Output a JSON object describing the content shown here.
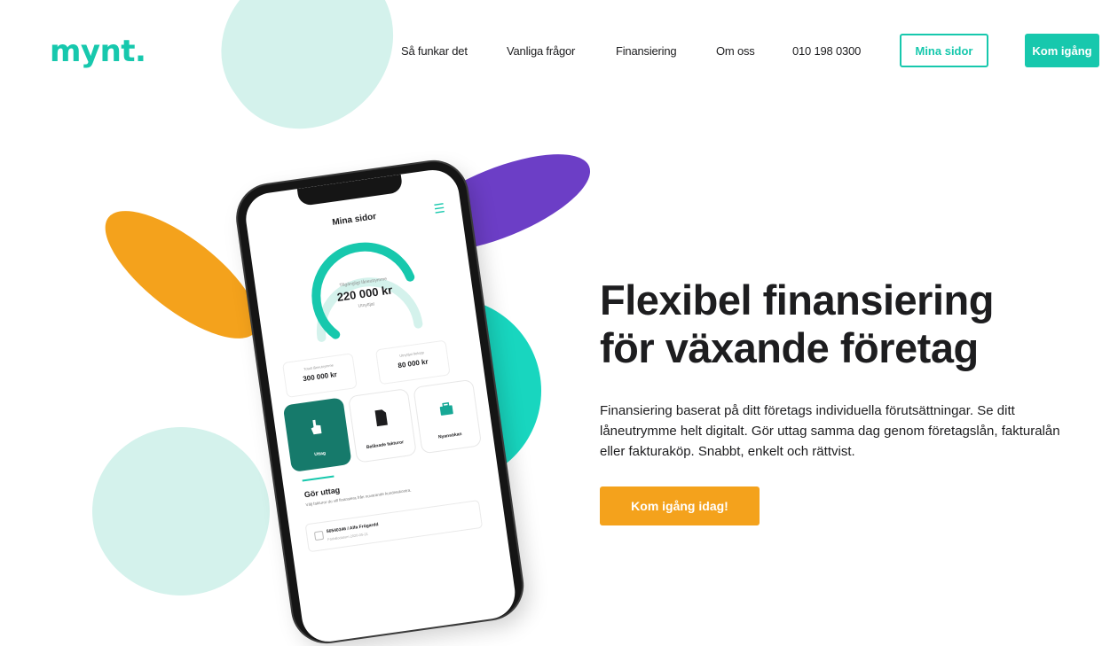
{
  "header": {
    "logo": "mynt.",
    "nav": [
      "Så funkar det",
      "Vanliga frågor",
      "Finansiering",
      "Om oss",
      "010 198 0300"
    ],
    "mina_sidor": "Mina sidor",
    "kom_igang": "Kom igång"
  },
  "hero": {
    "title_line1": "Flexibel finansiering",
    "title_line2": "för växande företag",
    "text": "Finansiering baserat på ditt företags individuella förutsättningar. Se ditt låneutrymme helt digitalt. Gör uttag samma dag genom företagslån, fakturalån eller fakturaköp. Snabbt, enkelt och rättvist.",
    "cta": "Kom igång idag!"
  },
  "phone": {
    "title": "Mina sidor",
    "gauge_label": "Tillgängligt låneutrymme",
    "gauge_amount": "220 000 kr",
    "gauge_sub": "Utnyttjat",
    "gauge_fill": 0.78,
    "card1_label": "Totalt låneutrymme",
    "card1_value": "300 000 kr",
    "card2_label": "Utnyttjat belopp",
    "card2_value": "80 000 kr",
    "tiles": [
      "Uttag",
      "Belånade fakturor",
      "Nyansökan"
    ],
    "gor_uttag_title": "Gör uttag",
    "gor_uttag_text": "Välj fakturor du vill finansiera från nuvarande kundreskontra.",
    "row_text": "56540346 / Alfa Frögardd",
    "row_sub": "Förfallodatum 2020-05-21"
  },
  "colors": {
    "brand": "#17c8ad",
    "orange": "#f4a21c",
    "purple": "#6c3ec6",
    "mint": "#d4f2ec"
  }
}
